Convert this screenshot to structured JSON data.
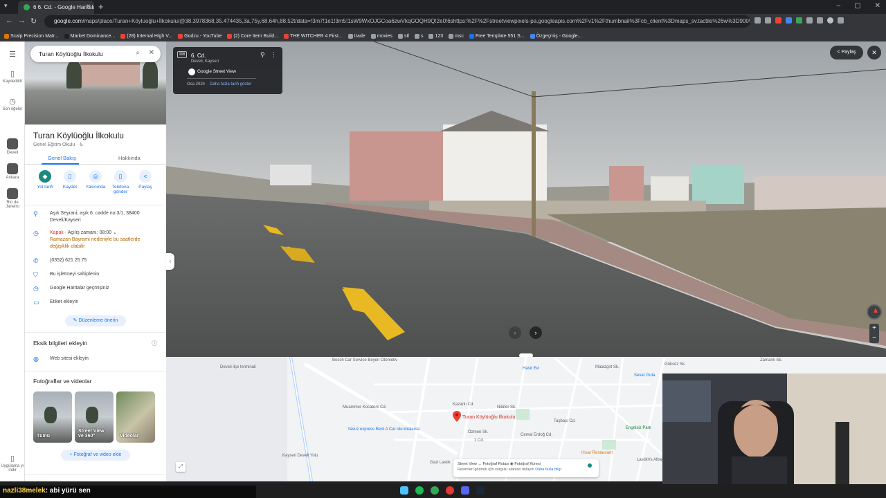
{
  "browser": {
    "tab_title": "6 6. Cd. - Google Haritalar",
    "url_host": "google.com",
    "url_rest": "/maps/place/Turan+Köylüoğlu+İlkokulu/@38.3978368,35.474435,3a,75y,68.64h,88.52t/data=!3m7!1e1!3m5!1sW9WxOJGCoa6zwVkqGOQH9Q!2e0!6shttps:%2F%2Fstreetviewpixels-pa.googleapis.com%2Fv1%2Fthumbnail%3Fcb_client%3Dmaps_sv.tactile%26w%3D900%26h%3D600%26pitch%3D1.48340796052...",
    "bookmarks": [
      {
        "label": "Scalp Precision Matr...",
        "color": "#e37400"
      },
      {
        "label": "Market Dominance...",
        "color": "#202124"
      },
      {
        "label": "(28) Internal High V...",
        "color": "#ea4335"
      },
      {
        "label": "Godzu - YouTube",
        "color": "#ea4335"
      },
      {
        "label": "(2) Core Item Build...",
        "color": "#ea4335"
      },
      {
        "label": "THE WITCHER 4 First...",
        "color": "#ea4335"
      },
      {
        "label": "trade",
        "color": "#9aa0a6"
      },
      {
        "label": "movies",
        "color": "#9aa0a6"
      },
      {
        "label": "stl",
        "color": "#9aa0a6"
      },
      {
        "label": "s",
        "color": "#9aa0a6"
      },
      {
        "label": "123",
        "color": "#9aa0a6"
      },
      {
        "label": "msc",
        "color": "#9aa0a6"
      },
      {
        "label": "Free Template 551 S...",
        "color": "#1a73e8"
      },
      {
        "label": "Özgeçmiş - Google...",
        "color": "#4285f4"
      }
    ]
  },
  "rail": {
    "menu_icon": "menu-icon",
    "saved": "Kaydedildi",
    "recent": "Son öğeler",
    "recent_places": [
      "Develi",
      "Ankara",
      "Rio de Janeiro"
    ],
    "get_app": "Uygulama yı indir"
  },
  "search": {
    "query": "Turan Köylüoğlu İlkokulu"
  },
  "place": {
    "title": "Turan Köylüoğlu İlkokulu",
    "category": "Genel Eğitim Okulu · ♿",
    "tabs": {
      "overview": "Genel Bakış",
      "about": "Hakkında"
    },
    "actions": [
      "Yol tarifi",
      "Kaydet",
      "Yakınında",
      "Telefona gönder",
      "Paylaş"
    ],
    "address": "Aşık Seyrani, aşık 6. cadde no:3/1, 38400 Develi/Kayseri",
    "hours_closed": "Kapalı",
    "hours_open": " · Açılış zamanı: 08:00",
    "holiday_note": "Ramazan Bayramı nedeniyle bu saatlerde değişiklik olabilir",
    "phone": "(0352) 621 25 75",
    "claim": "Bu işletmeyi sahiplenin",
    "history": "Google Haritalar geçmişiniz",
    "add_label": "Etiket ekleyin",
    "suggest_edit": "Düzenleme önerin",
    "missing_info_title": "Eksik bilgileri ekleyin",
    "add_website": "Web sitesi ekleyin",
    "photos_title": "Fotoğraflar ve videolar",
    "photos": [
      "Tümü",
      "Street View ve 360°",
      "Videolar"
    ],
    "add_photo": "Fotoğraf ve video ekle"
  },
  "streetview": {
    "street": "6. Cd.",
    "city": "Develi, Kayseri",
    "provider": "Google Street View",
    "date": "Oca 2024",
    "more_dates": "Daha fazla tarih göster",
    "share": "Paylaş",
    "keyboard_hint": "⌨"
  },
  "map": {
    "labels": [
      {
        "text": "Develi ilçe terminali",
        "cls": ""
      },
      {
        "text": "Bosch Car Service Beyen Otomotiv",
        "cls": ""
      },
      {
        "text": "Muammer Kocatürk Cd.",
        "cls": ""
      },
      {
        "text": "Yavuz express Rent A Car oto kiralama",
        "cls": "map-blue"
      },
      {
        "text": "Kayseri Develi Yolu",
        "cls": ""
      },
      {
        "text": "Hasir Evi",
        "cls": "map-blue"
      },
      {
        "text": "Kazanlı Cd.",
        "cls": ""
      },
      {
        "text": "Nilüfer Sk.",
        "cls": ""
      },
      {
        "text": "Özmen Sk.",
        "cls": ""
      },
      {
        "text": "Gazi Lastik",
        "cls": ""
      },
      {
        "text": "Taşbaşı Cd.",
        "cls": ""
      },
      {
        "text": "Cemal Erdoğ Cd.",
        "cls": ""
      },
      {
        "text": "Malazgirt Sk.",
        "cls": ""
      },
      {
        "text": "Sevar Gıda",
        "cls": "map-blue"
      },
      {
        "text": "Engelsiz Park",
        "cls": "map-green"
      },
      {
        "text": "Hisar Restaurant",
        "cls": "map-orange"
      },
      {
        "text": "LastikVs Albayrak Tic.",
        "cls": ""
      },
      {
        "text": "Göksöz Sk.",
        "cls": ""
      },
      {
        "text": "Zamanlı Sk.",
        "cls": ""
      },
      {
        "text": "1 Cd.",
        "cls": ""
      }
    ],
    "place_label": "Turan Köylüoğlu İlkokulu",
    "legend_line1": "Street View  ↔ Fotoğraf Rotası  ◉ Fotoğraf Küresi",
    "legend_line2": "Resimleri görmek için vurgulu alanları tıklayın",
    "legend_link": "Daha fazla bilgi"
  },
  "chat": {
    "user": "nazli38melek",
    "message": ": abi yürü sen"
  },
  "colors": {
    "accent": "#1a73e8",
    "closed": "#d93025",
    "primary_action": "#1a8a7e",
    "road_marking": "#e8b923"
  }
}
